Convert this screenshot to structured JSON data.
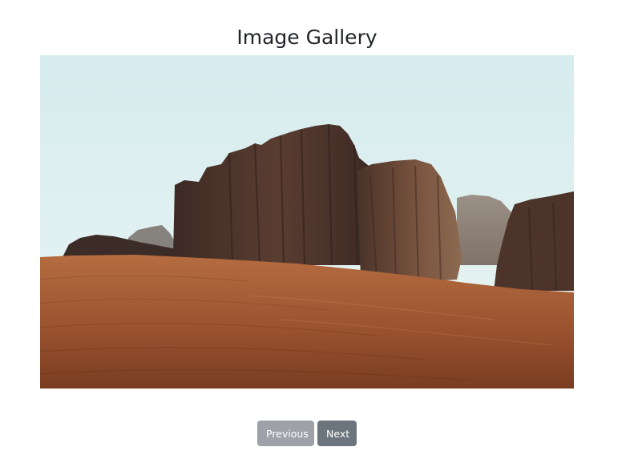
{
  "gallery": {
    "title": "Image Gallery",
    "image_alt": "Desert sand dune with rock formations",
    "previous_label": "Previous",
    "next_label": "Next"
  },
  "colors": {
    "previous_button": "#9ea2a8",
    "next_button": "#6c757d",
    "title_text": "#212529"
  }
}
